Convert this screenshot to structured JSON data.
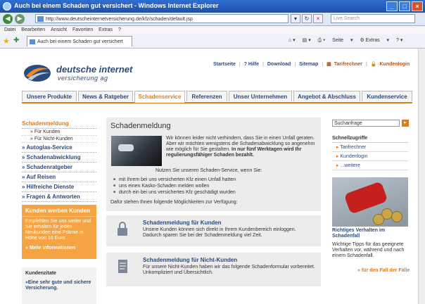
{
  "window": {
    "title": "Auch bei einem Schaden gut versichert - Windows Internet Explorer",
    "url": "http://www.deutscheinternetversicherung.de/kfz/schaden/default.jsp",
    "search_placeholder": "Live Search",
    "tab_title": "Auch bei einem Schaden gut versichert"
  },
  "menubar": [
    "Datei",
    "Bearbeiten",
    "Ansicht",
    "Favoriten",
    "Extras",
    "?"
  ],
  "toolbar": {
    "page": "Seite",
    "extras": "Extras"
  },
  "logo": {
    "line1": "deutsche internet",
    "line2": "versicherung ag"
  },
  "toplinks": [
    "Startseite",
    "? Hilfe",
    "Download",
    "Sitemap",
    "Tarifrechner",
    "Kundenlogin"
  ],
  "navtabs": [
    "Unsere Produkte",
    "News & Ratgeber",
    "Schadenservice",
    "Referenzen",
    "Unser Unternehmen",
    "Angebot & Abschluss",
    "Kundenservice"
  ],
  "leftnav": {
    "items": [
      {
        "label": "Schadenmeldung",
        "active": true
      },
      {
        "label": "Autoglas-Service"
      },
      {
        "label": "Schadenabwicklung"
      },
      {
        "label": "Schadenratgeber"
      },
      {
        "label": "Auf Reisen"
      },
      {
        "label": "Hilfreiche Dienste"
      },
      {
        "label": "Fragen & Antworten"
      }
    ],
    "subitems": [
      "Für Kunden",
      "Für Nicht-Kunden"
    ]
  },
  "promo": {
    "title": "Kunden werben Kunden",
    "text": "Empfehlen Sie uns weiter und Sie erhalten für jeden Neukunden eine Prämie in Höhe von 16 Euro.",
    "link": "» Mehr Informationen"
  },
  "quotes": {
    "title": "Kundenzitate",
    "text": "»Eine sehr gute und sichere Versicherung."
  },
  "main": {
    "title": "Schadenmeldung",
    "intro": "Wir können leider nicht verhindern, dass Sie in einen Unfall geraten. Aber wir möchten wenigstens die Schadenabwicklung so angenehm wie möglich für Sie gestalten.",
    "intro_bold": "In nur fünf Werktagen wird Ihr regulierungsfähiger Schaden bezahlt.",
    "service_text": "Nutzen Sie unseren Schaden-Service, wenn Sie:",
    "bullets": [
      "mit Ihrem bei uns versicherten Kfz einen Unfall hatten",
      "uns einen Kasko-Schaden melden wollen",
      "durch ein bei uns versichertes Kfz geschädigt wurden"
    ],
    "after": "Dafür stehen Ihnen folgende Möglichkeiten zur Verfügung:"
  },
  "cards": [
    {
      "title": "Schadenmeldung für Kunden",
      "text": "Unsere Kunden können sich direkt in Ihrem Kundenbereich einloggen. Dadurch sparen Sie bei der Schadenmeldung viel Zeit."
    },
    {
      "title": "Schadenmeldung für Nicht-Kunden",
      "text": "Für unsere Nicht-Kunden haben wir das folgende Schadenformular vorbereitet. Unkompliziert und Übersichtlich."
    }
  ],
  "right": {
    "search_placeholder": "Suchanfrage",
    "quick_title": "Schnellzugriffe",
    "quick": [
      "Tarifrechner",
      "Kundenlogin",
      "...weitere"
    ],
    "teaser_title": "Richtiges Verhalten im Schadenfall",
    "teaser_text": "Wichtige Tipps für das geeignete Verhalten vor, während und nach einem Schadenfall.",
    "teaser_link": "» für den Fall der Fälle"
  },
  "colors": {
    "accent": "#e07b1a",
    "brand": "#2a4b7c",
    "ie_title": "#1c4fae"
  }
}
